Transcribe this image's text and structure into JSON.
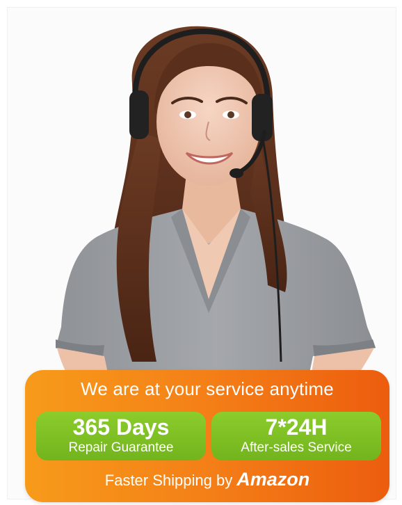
{
  "panel": {
    "headline": "We are at your service anytime",
    "badges": [
      {
        "big": "365 Days",
        "small": "Repair Guarantee"
      },
      {
        "big": "7*24H",
        "small": "After-sales Service"
      }
    ],
    "shipping_text": "Faster Shipping by",
    "shipping_brand": "Amazon"
  },
  "colors": {
    "panel_orange_start": "#f79b1a",
    "panel_orange_end": "#ec5d0e",
    "badge_green": "#7cbf22"
  },
  "illustration": {
    "subject": "customer-service-agent-with-headset"
  }
}
